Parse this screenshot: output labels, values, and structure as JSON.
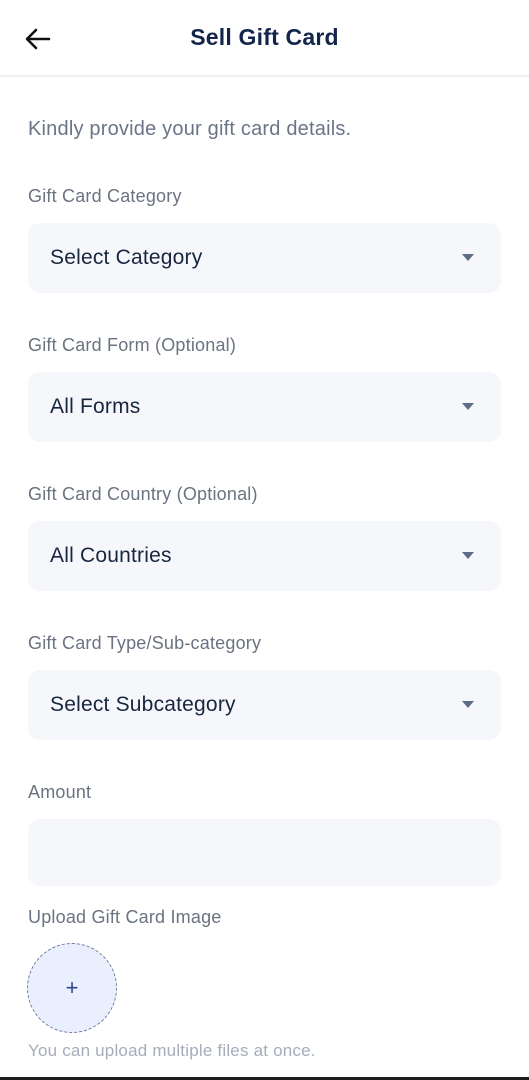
{
  "header": {
    "title": "Sell Gift Card",
    "back_icon": "arrow-left-icon"
  },
  "intro": "Kindly provide your gift card details.",
  "fields": {
    "category": {
      "label": "Gift Card Category",
      "value": "Select Category"
    },
    "form": {
      "label": "Gift Card Form (Optional)",
      "value": "All Forms"
    },
    "country": {
      "label": "Gift Card Country (Optional)",
      "value": "All Countries"
    },
    "subcategory": {
      "label": "Gift Card Type/Sub-category",
      "value": "Select Subcategory"
    },
    "amount": {
      "label": "Amount",
      "value": ""
    }
  },
  "upload": {
    "label": "Upload Gift Card Image",
    "icon": "plus-icon",
    "glyph": "+",
    "hint": "You can upload multiple files at once."
  },
  "colors": {
    "title": "#13264a",
    "field_bg": "#f5f7fa",
    "upload_bg": "#e9effc",
    "label": "#6b7380"
  }
}
